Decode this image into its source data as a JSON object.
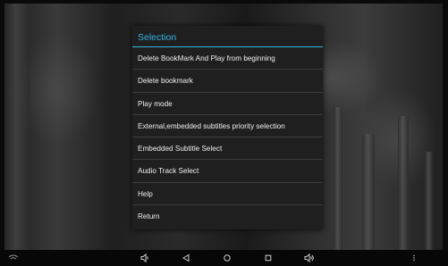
{
  "dialog": {
    "title": "Selection",
    "accent_color": "#33b5e5",
    "items": [
      {
        "label": "Delete BookMark And Play from beginning"
      },
      {
        "label": "Delete bookmark"
      },
      {
        "label": "Play mode"
      },
      {
        "label": "External,embedded subtitles priority selection"
      },
      {
        "label": "Embedded Subtitle Select"
      },
      {
        "label": "Audio Track Select"
      },
      {
        "label": "Help"
      },
      {
        "label": "Return"
      }
    ]
  },
  "navbar": {
    "icons": [
      "wifi-icon",
      "volume-down-icon",
      "back-icon",
      "home-icon",
      "recents-icon",
      "volume-up-icon",
      "more-icon"
    ]
  }
}
